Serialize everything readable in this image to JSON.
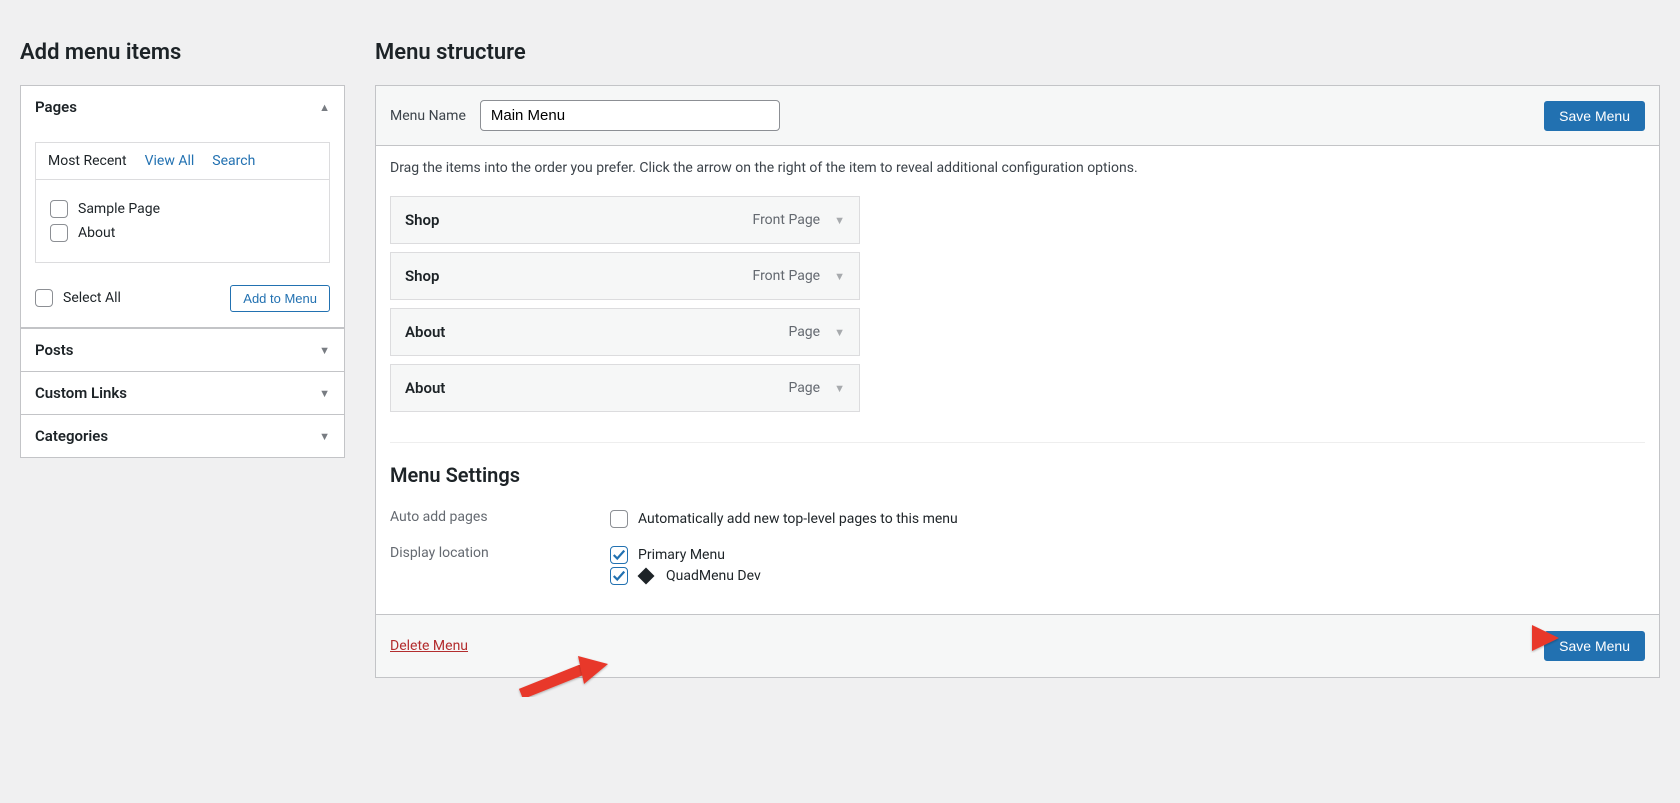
{
  "left": {
    "heading": "Add menu items",
    "pages": {
      "title": "Pages",
      "tabs": {
        "recent": "Most Recent",
        "view_all": "View All",
        "search": "Search"
      },
      "items": [
        "Sample Page",
        "About"
      ],
      "select_all": "Select All",
      "add_button": "Add to Menu"
    },
    "sections": [
      "Posts",
      "Custom Links",
      "Categories"
    ]
  },
  "right": {
    "heading": "Menu structure",
    "menu_name_label": "Menu Name",
    "menu_name_value": "Main Menu",
    "save_button": "Save Menu",
    "instructions": "Drag the items into the order you prefer. Click the arrow on the right of the item to reveal additional configuration options.",
    "items": [
      {
        "title": "Shop",
        "type": "Front Page"
      },
      {
        "title": "Shop",
        "type": "Front Page"
      },
      {
        "title": "About",
        "type": "Page"
      },
      {
        "title": "About",
        "type": "Page"
      }
    ],
    "settings": {
      "heading": "Menu Settings",
      "auto_add_label": "Auto add pages",
      "auto_add_option": "Automatically add new top-level pages to this menu",
      "display_label": "Display location",
      "locations": [
        {
          "label": "Primary Menu",
          "checked": true
        },
        {
          "label": "QuadMenu Dev",
          "checked": true,
          "icon": true
        }
      ]
    },
    "delete_label": "Delete Menu"
  }
}
